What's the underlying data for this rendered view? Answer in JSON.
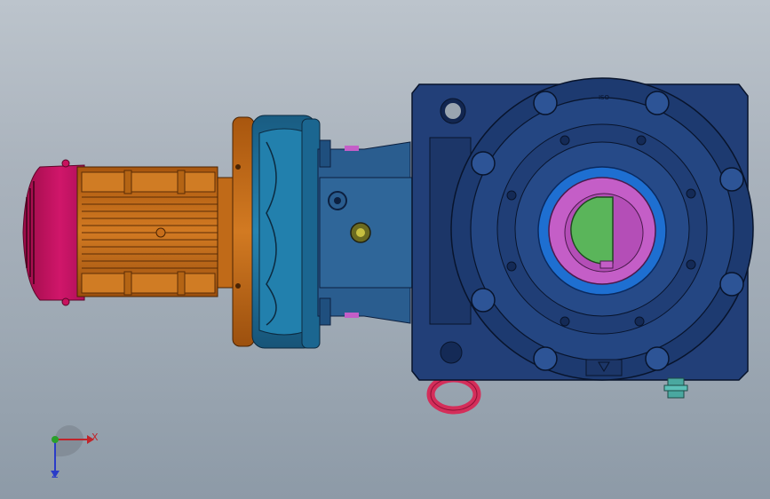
{
  "viewport": {
    "background_top": "#bcc4cc",
    "background_bottom": "#8d9aa7"
  },
  "model": {
    "components": [
      {
        "name": "motor-fan-cover",
        "color": "#c8125e"
      },
      {
        "name": "motor-body",
        "color": "#c86e1a"
      },
      {
        "name": "motor-flange",
        "color": "#c86e1a"
      },
      {
        "name": "adapter-housing",
        "color": "#1f6f9a"
      },
      {
        "name": "input-housing",
        "color": "#2a5d8f"
      },
      {
        "name": "gearbox-housing",
        "color": "#223f78"
      },
      {
        "name": "output-bearing-ring",
        "color": "#1e6fd1"
      },
      {
        "name": "hollow-shaft-bore",
        "color": "#c45ec7"
      },
      {
        "name": "output-shaft",
        "color": "#5ab55a"
      },
      {
        "name": "lifting-eye",
        "color": "#d42e5a"
      },
      {
        "name": "breather-plug",
        "color": "#4aa8a0"
      }
    ],
    "housing_marking": "ISO"
  },
  "triad": {
    "x_label": "X",
    "z_label": "Z",
    "x_color": "#c0242a",
    "y_color": "#2aa02a",
    "z_color": "#2a3cc8"
  }
}
